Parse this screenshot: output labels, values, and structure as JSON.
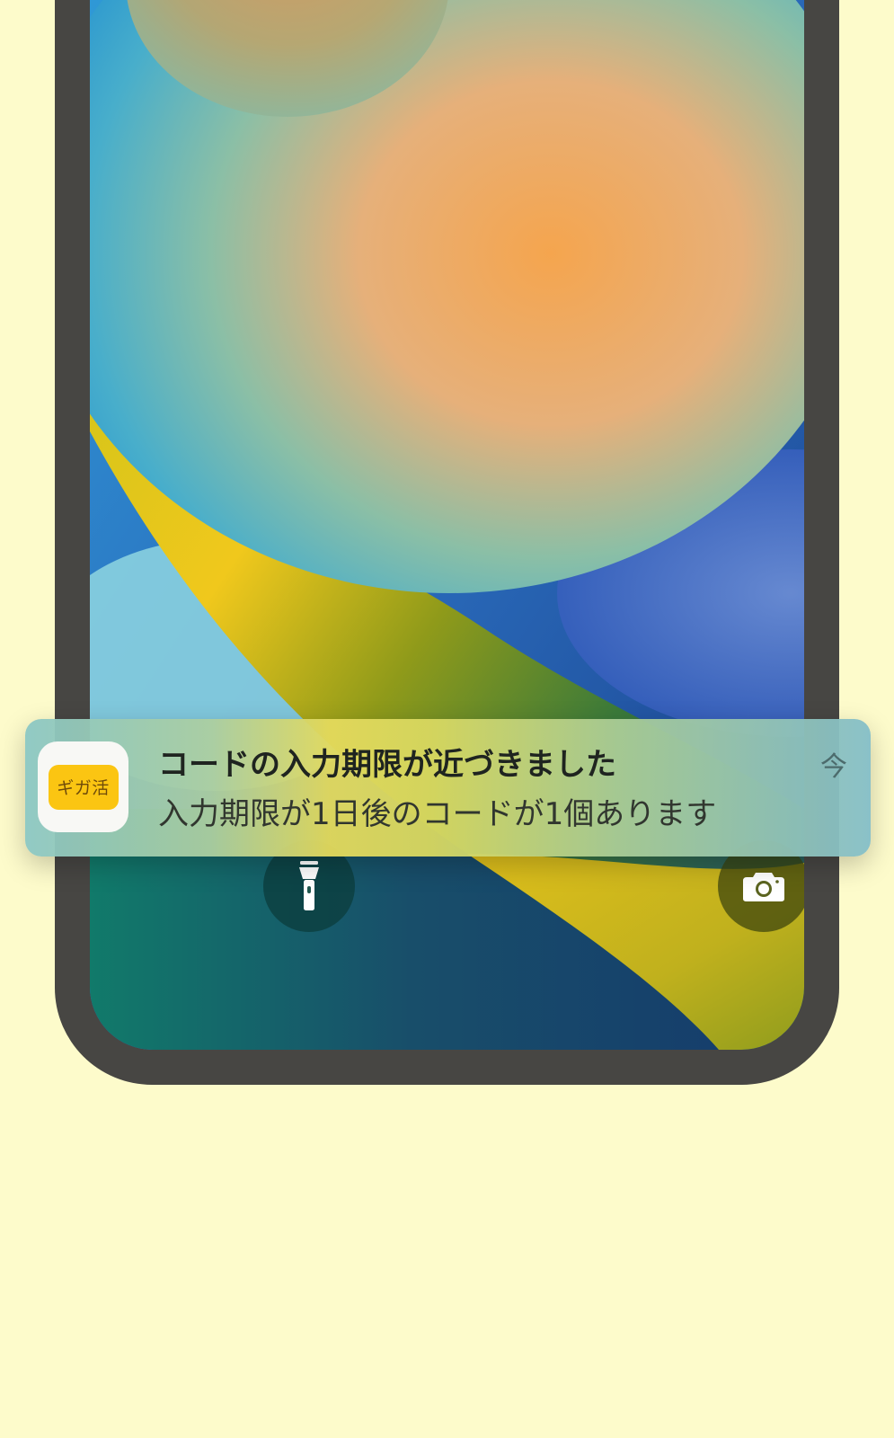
{
  "notification": {
    "app_icon_label": "ギガ活",
    "title": "コードの入力期限が近づきました",
    "body": "入力期限が1日後のコードが1個あります",
    "time": "今"
  },
  "quick_actions": {
    "left_icon": "flashlight-icon",
    "right_icon": "camera-icon"
  },
  "colors": {
    "background": "#fdfbcb",
    "phone_frame": "#474643",
    "app_icon_accent": "#fbc512"
  }
}
